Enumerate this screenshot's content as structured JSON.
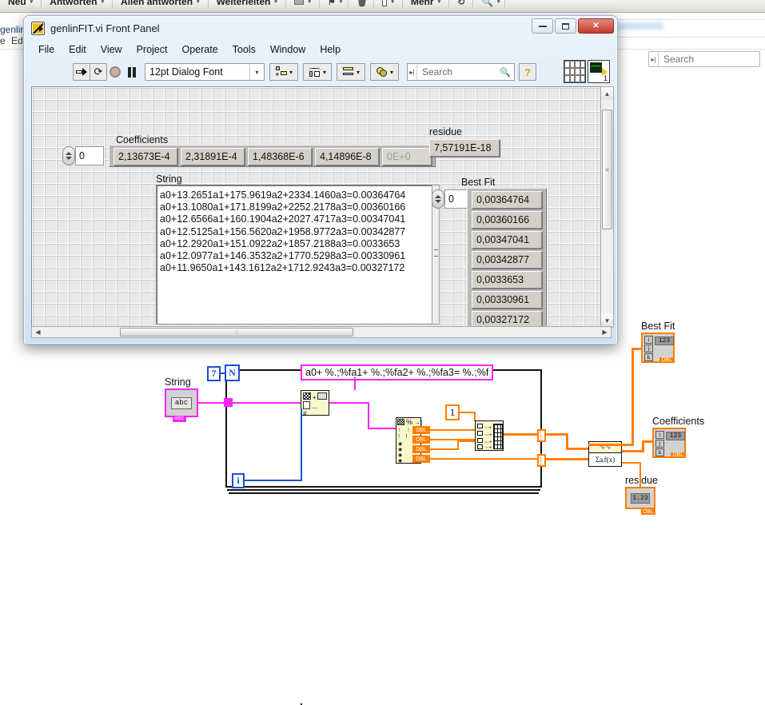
{
  "background_app": {
    "toolbar_items": [
      {
        "label": "Neu",
        "caret": "▾"
      },
      {
        "label": "Antworten",
        "caret": "▾"
      },
      {
        "label": "Allen antworten",
        "caret": "▾"
      },
      {
        "label": "Weiterleiten",
        "caret": "▾"
      },
      {
        "label": "",
        "caret": "▾"
      },
      {
        "label": "",
        "caret": "▾"
      },
      {
        "label": "",
        "caret": ""
      },
      {
        "label": "",
        "caret": "▾"
      },
      {
        "label": "Mehr",
        "caret": "▾"
      },
      {
        "label": "",
        "caret": ""
      },
      {
        "label": "",
        "caret": "▾"
      }
    ],
    "sidebar_label": "genlin",
    "menu_left": "e",
    "menu_edit": "Ed",
    "search_placeholder": "Search",
    "search_grip_icon": "grip-icon"
  },
  "labview_window": {
    "title": "genlinFIT.vi Front Panel",
    "app_icon": "labview-vi-icon",
    "window_buttons": {
      "minimize": "minimize-icon",
      "maximize": "maximize-icon",
      "close": "✕"
    },
    "menu": [
      "File",
      "Edit",
      "View",
      "Project",
      "Operate",
      "Tools",
      "Window",
      "Help"
    ],
    "toolbar": {
      "run_icon": "run-arrow-icon",
      "run_continuous_icon": "run-continuously-icon",
      "abort_icon": "abort-execution-icon",
      "pause_icon": "pause-icon",
      "font_selector": "12pt Dialog Font",
      "font_caret": "▾",
      "align_icon": "align-objects-icon",
      "distribute_icon": "distribute-objects-icon",
      "resize_icon": "resize-objects-icon",
      "reorder_icon": "reorder-objects-icon",
      "dropdown_caret": "▾",
      "search_placeholder": "Search",
      "search_icon": "magnifier-icon",
      "help_icon": "context-help-icon",
      "connector_pane_icon": "connector-pane-icon",
      "vi_icon": "vi-icon",
      "vi_icon_number": "1"
    },
    "panel": {
      "coefficients": {
        "label": "Coefficients",
        "index_value": "0",
        "values": [
          "2,13673E-4",
          "2,31891E-4",
          "1,48368E-6",
          "4,14896E-8"
        ],
        "empty_cell": "0E+0"
      },
      "residue": {
        "label": "residue",
        "value": "7,57191E-18"
      },
      "string": {
        "label": "String",
        "lines": [
          "a0+13.2651a1+175.9619a2+2334.1460a3=0.00364764",
          "a0+13.1080a1+171.8199a2+2252.2178a3=0.00360166",
          "a0+12.6566a1+160.1904a2+2027.4717a3=0.00347041",
          "a0+12.5125a1+156.5620a2+1958.9772a3=0.00342877",
          "a0+12.2920a1+151.0922a2+1857.2188a3=0.0033653",
          "a0+12.0977a1+146.3532a2+1770.5298a3=0.00330961",
          "a0+11.9650a1+143.1612a2+1712.9243a3=0.00327172"
        ]
      },
      "best_fit": {
        "label": "Best Fit",
        "index_value": "0",
        "values": [
          "0,00364764",
          "0,00360166",
          "0,00347041",
          "0,00342877",
          "0,0033653",
          "0,00330961",
          "0,00327172"
        ]
      }
    },
    "scrollbars": {
      "v_up": "▲",
      "v_down": "▼",
      "v_grip": "≡",
      "h_left": "◀",
      "h_right": "▶",
      "h_grip": "⦙⦙"
    }
  },
  "block_diagram": {
    "loop_count_constant": "7",
    "loop_n_terminal": "N",
    "loop_i_terminal": "i",
    "string_control_label": "String",
    "string_control_glyph": "abc",
    "string_control_tag": "abc",
    "format_string_constant": "a0+ %.;%fa1+ %.;%fa2+ %.;%fa3= %.;%f",
    "format_node_icon": "format-into-string-icon",
    "scan_node_icon": "scan-from-string-icon",
    "scan_outputs": [
      "DBL",
      "DBL",
      "DBL",
      "DBL"
    ],
    "build_array_icon": "build-array-icon",
    "index_constant": "1",
    "fit_node_icon": "general-ls-linear-fit-icon",
    "fit_node_label": "Σaᵢf(x)",
    "index_array_icon": "index-array-icon",
    "indicators": [
      {
        "label": "Best Fit",
        "type": "array",
        "datatype": "DBL",
        "glyph": "123"
      },
      {
        "label": "Coefficients",
        "type": "array",
        "datatype": "DBL",
        "glyph": "123"
      },
      {
        "label": "residue",
        "type": "scalar",
        "datatype": "DBL",
        "glyph": "1.23"
      }
    ],
    "array_index_letters": [
      "i",
      "j",
      "k"
    ]
  },
  "colors": {
    "wire_orange": "#ff7e00",
    "wire_blue": "#1a4fd6",
    "wire_pink": "#ff22ff",
    "node_yellow": "#fbf7cd",
    "window_blue": "#cfe2f4"
  }
}
